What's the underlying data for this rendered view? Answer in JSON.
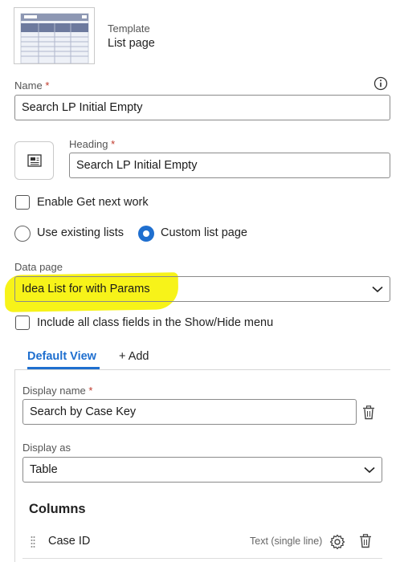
{
  "template": {
    "label": "Template",
    "name": "List page"
  },
  "name_field": {
    "label": "Name",
    "required_mark": "*",
    "value": "Search LP Initial Empty"
  },
  "heading_field": {
    "label": "Heading",
    "required_mark": "*",
    "value": "Search LP Initial Empty"
  },
  "get_next_work": {
    "label": "Enable Get next work"
  },
  "list_source": {
    "options": [
      {
        "label": "Use existing lists",
        "selected": false
      },
      {
        "label": "Custom list page",
        "selected": true
      }
    ]
  },
  "data_page": {
    "label": "Data page",
    "value": "Idea List for with Params"
  },
  "include_fields": {
    "label": "Include all class fields in the Show/Hide menu"
  },
  "tabs": {
    "default_view": "Default View",
    "add": "+ Add"
  },
  "view": {
    "display_name_label": "Display name",
    "display_name_required": "*",
    "display_name_value": "Search by Case Key",
    "display_as_label": "Display as",
    "display_as_value": "Table"
  },
  "columns": {
    "title": "Columns",
    "rows": [
      {
        "name": "Case ID",
        "type": "Text (single line)"
      }
    ]
  },
  "colors": {
    "accent": "#1f6fcf",
    "required": "#c0392b",
    "highlight": "#f6f200"
  }
}
